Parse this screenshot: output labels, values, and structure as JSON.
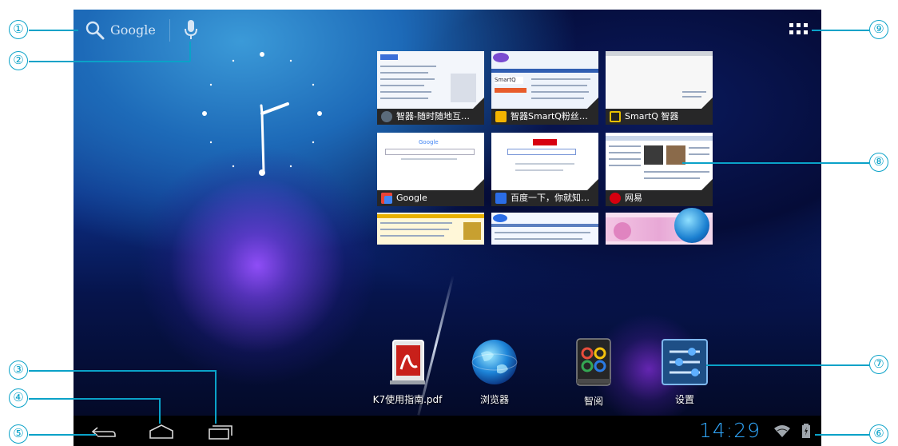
{
  "search": {
    "engine_label": "Google",
    "search_icon": "search-icon",
    "mic_icon": "microphone-icon"
  },
  "apps_drawer_icon": "all-apps-grid-icon",
  "thumbnails": [
    {
      "label": "智器-随时随地互…",
      "icon": "globe-favicon",
      "color": "#5b6b7b"
    },
    {
      "label": "智器SmartQ粉丝…",
      "icon": "folder-favicon",
      "color": "#f4b400"
    },
    {
      "label": "SmartQ 智器",
      "icon": "smartq-favicon",
      "color": "#222222"
    },
    {
      "label": "Google",
      "icon": "google-favicon",
      "color": "#4285f4"
    },
    {
      "label": "百度一下，你就知…",
      "icon": "baidu-favicon",
      "color": "#2b6de6"
    },
    {
      "label": "网易",
      "icon": "netease-favicon",
      "color": "#d7000f"
    }
  ],
  "dock": [
    {
      "label": "K7使用指南.pdf",
      "icon": "pdf-reader-icon"
    },
    {
      "label": "浏览器",
      "icon": "browser-globe-icon"
    },
    {
      "label": "智阅",
      "icon": "reader-book-icon"
    },
    {
      "label": "设置",
      "icon": "settings-sliders-icon"
    }
  ],
  "status": {
    "time": "14:29",
    "wifi_icon": "wifi-icon",
    "battery_icon": "battery-charging-icon"
  },
  "nav": {
    "back_icon": "back-icon",
    "home_icon": "home-icon",
    "recents_icon": "recent-apps-icon"
  },
  "callouts": [
    "①",
    "②",
    "③",
    "④",
    "⑤",
    "⑥",
    "⑦",
    "⑧",
    "⑨"
  ],
  "colors": {
    "callout": "#0aa2c8",
    "clock_text": "#31a9ff"
  }
}
